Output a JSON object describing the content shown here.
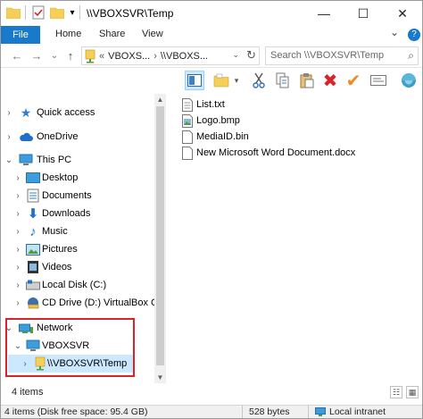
{
  "titlebar": {
    "title": "\\\\VBOXSVR\\Temp",
    "minimize_glyph": "—",
    "maximize_glyph": "☐",
    "close_glyph": "✕",
    "dropdown_glyph": "▾"
  },
  "ribbon": {
    "tabs": [
      "File",
      "Home",
      "Share",
      "View"
    ],
    "expand_glyph": "⌄",
    "help_glyph": "?"
  },
  "navigation": {
    "back_glyph": "←",
    "forward_glyph": "→",
    "recent_glyph": "⌄",
    "up_glyph": "↑",
    "address_prefix": "«",
    "address_segments": [
      "VBOXS...",
      "\\\\VBOXS..."
    ],
    "address_separator": "›",
    "address_dropdown_glyph": "⌄",
    "refresh_glyph": "↻",
    "search_placeholder": "Search \\\\VBOXSVR\\Temp",
    "search_glyph": "⌕"
  },
  "toolbar": {
    "buttons": [
      "preview-pane",
      "new-folder",
      "cut",
      "copy",
      "paste",
      "delete",
      "checkmark",
      "rename",
      "properties"
    ],
    "new_folder_dropdown_glyph": "▾"
  },
  "tree": [
    {
      "label": "Quick access",
      "icon": "star-icon",
      "expand": "›"
    },
    {
      "label": "OneDrive",
      "icon": "cloud-icon",
      "expand": "›"
    },
    {
      "label": "This PC",
      "icon": "computer-icon",
      "expand": "⌄"
    },
    {
      "label": "Desktop",
      "icon": "desktop-folder-icon",
      "expand": "›"
    },
    {
      "label": "Documents",
      "icon": "documents-folder-icon",
      "expand": "›"
    },
    {
      "label": "Downloads",
      "icon": "downloads-folder-icon",
      "expand": "›"
    },
    {
      "label": "Music",
      "icon": "music-folder-icon",
      "expand": "›"
    },
    {
      "label": "Pictures",
      "icon": "pictures-folder-icon",
      "expand": "›"
    },
    {
      "label": "Videos",
      "icon": "videos-folder-icon",
      "expand": "›"
    },
    {
      "label": "Local Disk (C:)",
      "icon": "drive-icon",
      "expand": "›"
    },
    {
      "label": "CD Drive (D:) VirtualBox Gue",
      "icon": "cd-drive-icon",
      "expand": "›"
    },
    {
      "label": "Network",
      "icon": "network-icon",
      "expand": "⌄"
    },
    {
      "label": "VBOXSVR",
      "icon": "computer-icon",
      "expand": "⌄"
    },
    {
      "label": "\\\\VBOXSVR\\Temp",
      "icon": "network-folder-icon",
      "expand": "›",
      "selected": true
    }
  ],
  "files": [
    {
      "name": "List.txt",
      "icon": "text-file-icon"
    },
    {
      "name": "Logo.bmp",
      "icon": "bitmap-file-icon"
    },
    {
      "name": "MediaID.bin",
      "icon": "bin-file-icon"
    },
    {
      "name": "New Microsoft Word Document.docx",
      "icon": "docx-file-icon"
    }
  ],
  "status": {
    "item_count": "4 items",
    "details_glyph": "☷",
    "large_icons_glyph": "▦"
  },
  "bottom_bar": {
    "disk_info": "4 items (Disk free space: 95.4 GB)",
    "size": "528 bytes",
    "zone": "Local intranet"
  },
  "colors": {
    "file_tab_bg": "#1979ca",
    "selection_bg": "#cce8ff",
    "highlight_border": "#d9232a",
    "folder_yellow": "#f6cf57"
  }
}
